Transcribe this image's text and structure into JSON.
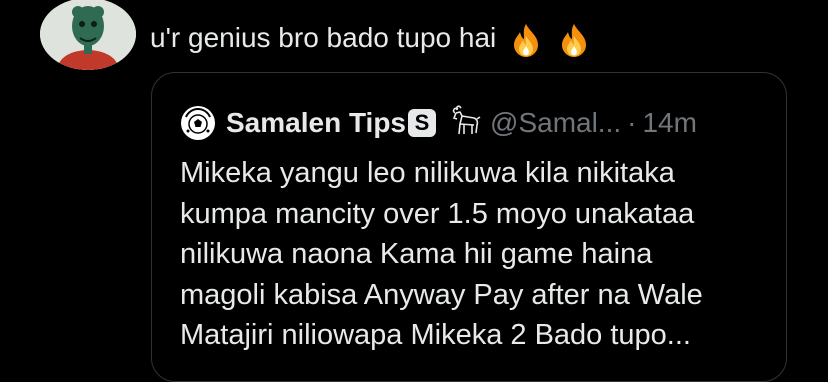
{
  "reply": {
    "text": "u'r genius bro bado tupo hai",
    "emojis": [
      "fire-icon",
      "fire-icon"
    ]
  },
  "quote": {
    "display_name": "Samalen Tips",
    "badge": "S",
    "handle": "@Samal...",
    "separator": "·",
    "time": "14m",
    "text_lines": [
      "Mikeka yangu leo nilikuwa kila nikitaka",
      "kumpa mancity over 1.5 moyo unakataa",
      "nilikuwa naona Kama hii game haina",
      "magoli kabisa Anyway Pay after na Wale",
      "Matajiri niliowapa Mikeka 2 Bado tupo..."
    ]
  },
  "colors": {
    "background": "#000000",
    "text_primary": "#e7e9ea",
    "text_secondary": "#71767b",
    "border": "#2f3336"
  }
}
